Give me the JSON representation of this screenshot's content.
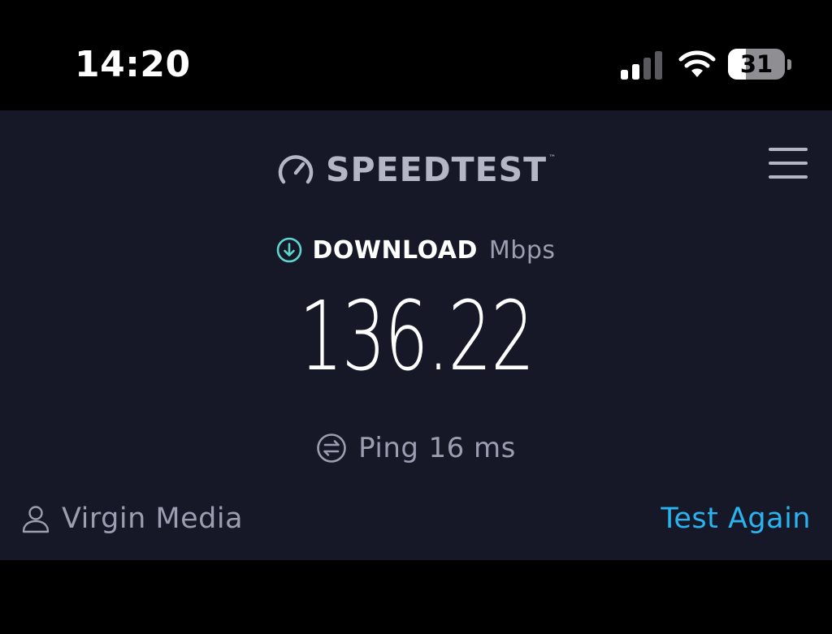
{
  "status_bar": {
    "time": "14:20",
    "battery_level": "31",
    "battery_fraction": 0.31,
    "signal_bars_active": 2,
    "signal_bars_total": 4
  },
  "header": {
    "logo_text": "SPEEDTEST",
    "logo_mark": "™",
    "logo_icon": "gauge-icon",
    "menu_icon": "hamburger-menu-icon"
  },
  "result": {
    "download_label": "DOWNLOAD",
    "download_unit": "Mbps",
    "download_icon": "download-arrow-circle-icon",
    "download_value": "136.22",
    "ping_label": "Ping",
    "ping_value": "16 ms",
    "ping_icon": "ping-circle-icon"
  },
  "footer": {
    "provider_icon": "person-icon",
    "provider_name": "Virgin Media",
    "test_again_label": "Test Again"
  },
  "colors": {
    "background": "#161828",
    "accent": "#2ab3ee",
    "download_accent": "#5ed6d0",
    "muted_text": "#9b9db0",
    "primary_text": "#ffffff"
  }
}
